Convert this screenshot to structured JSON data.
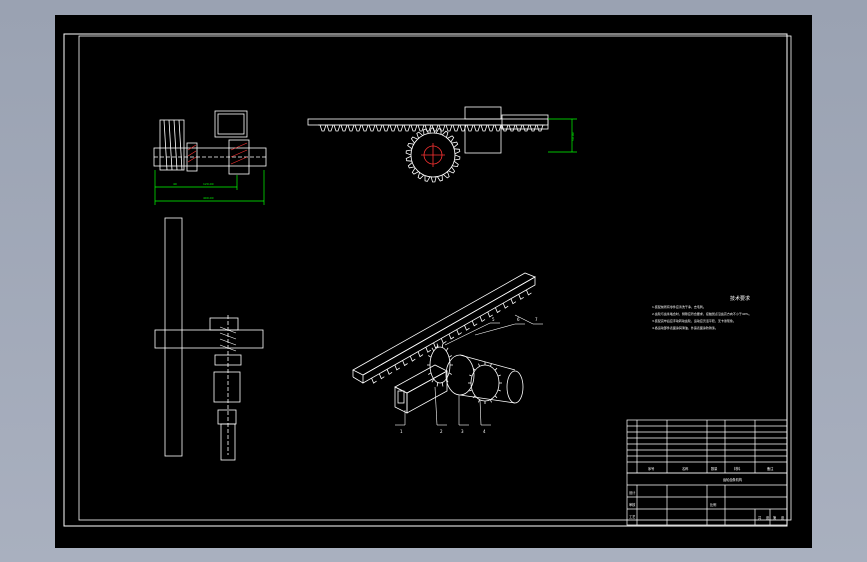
{
  "drawing": {
    "background": "#000000",
    "line_color": "#ffffff",
    "dim_color": "#00ff00",
    "hatch_color": "#ff3333"
  },
  "dimensions": {
    "top_view_small": "40",
    "top_view_mid": "120.00",
    "top_view_overall": "400.00",
    "rack_height": "50.00"
  },
  "callouts": [
    "1",
    "2",
    "3",
    "4",
    "5",
    "6",
    "7"
  ],
  "notes": {
    "title": "技术要求",
    "lines": [
      "1.装配前所有零件应清洗干净，去毛刺。",
      "2.齿轮与齿条啮合时，侧隙应符合要求，接触斑点沿齿高方向不小于40%。",
      "3.装配完毕后应手动转动齿轮，运动应灵活平稳，无卡滞现象。",
      "4.各运动部件表面涂润滑油，外露表面涂防锈漆。"
    ]
  },
  "title_block": {
    "bom_headers": [
      "序号",
      "名称",
      "数量",
      "材料",
      "备注"
    ],
    "title": "齿轮齿条机构",
    "labels": [
      "设计",
      "审核",
      "工艺",
      "比例",
      "共",
      "张",
      "第",
      "张"
    ]
  }
}
